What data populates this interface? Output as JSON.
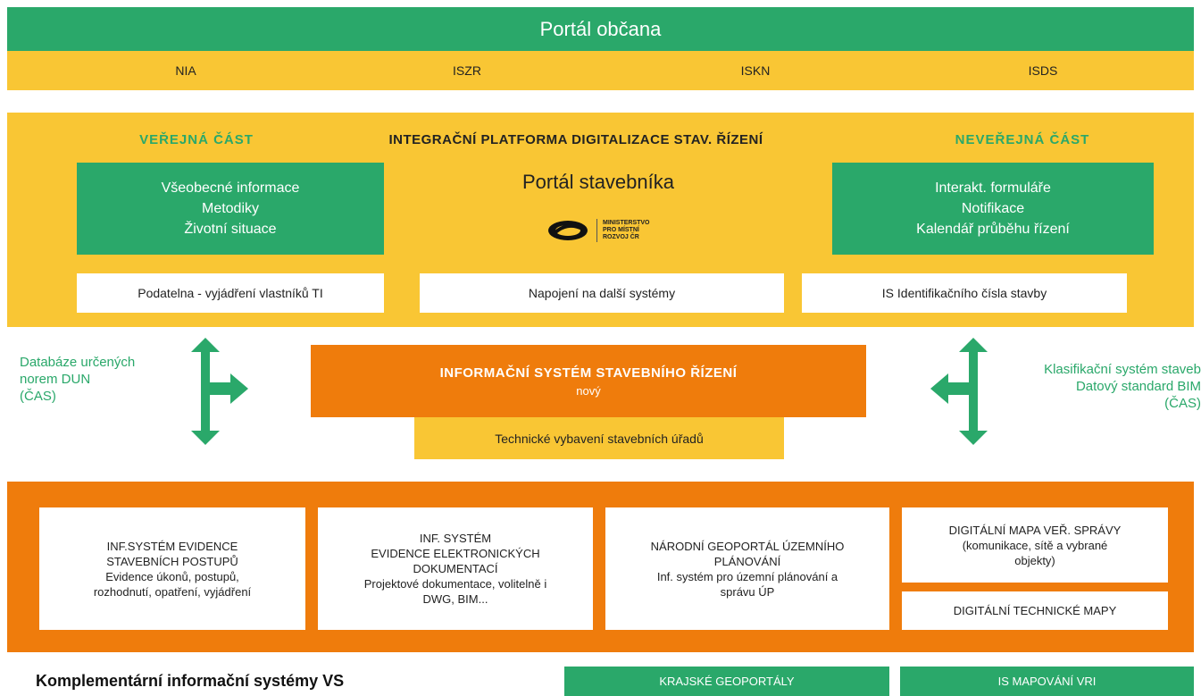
{
  "portal_obcana": "Portál občana",
  "top_systems": [
    "NIA",
    "ISZR",
    "ISKN",
    "ISDS"
  ],
  "platform": {
    "public_label": "VEŘEJNÁ ČÁST",
    "title": "INTEGRAČNÍ PLATFORMA DIGITALIZACE STAV. ŘÍZENÍ",
    "private_label": "NEVEŘEJNÁ ČÁST",
    "left_box": [
      "Všeobecné informace",
      "Metodiky",
      "Životní situace"
    ],
    "center_title": "Portál stavebníka",
    "logo_text": [
      "MINISTERSTVO",
      "PRO MÍSTNÍ",
      "ROZVOJ ČR"
    ],
    "right_box": [
      "Interakt. formuláře",
      "Notifikace",
      "Kalendář průběhu řízení"
    ],
    "white_boxes": [
      "Podatelna - vyjádření vlastníků TI",
      "Napojení na další systémy",
      "IS Identifikačního čísla stavby"
    ]
  },
  "middle": {
    "left_note": [
      "Databáze určených",
      "norem DUN",
      "(ČAS)"
    ],
    "main_title": "INFORMAČNÍ SYSTÉM STAVEBNÍHO ŘÍZENÍ",
    "main_sub": "nový",
    "tech": "Technické vybavení  stavebních úřadů",
    "right_note": [
      "Klasifikační systém staveb",
      "Datový  standard BIM",
      "(ČAS)"
    ]
  },
  "bottom_systems": {
    "box1": [
      "INF.SYSTÉM  EVIDENCE",
      "STAVEBNÍCH POSTUPŮ",
      "Evidence úkonů, postupů,",
      "rozhodnutí, opatření, vyjádření"
    ],
    "box2": [
      "INF. SYSTÉM",
      "EVIDENCE ELEKTRONICKÝCH",
      "DOKUMENTACÍ",
      "Projektové dokumentace, volitelně i",
      "DWG, BIM..."
    ],
    "box3": [
      "NÁRODNÍ GEOPORTÁL ÚZEMNÍHO",
      "PLÁNOVÁNÍ",
      "Inf. systém pro územní plánování a",
      "správu ÚP"
    ],
    "box4": [
      "DIGITÁLNÍ MAPA  VEŘ. SPRÁVY",
      "(komunikace, sítě a vybrané",
      "objekty)"
    ],
    "box5": "DIGITÁLNÍ TECHNICKÉ MAPY"
  },
  "footer": {
    "title": "Komplementární informační systémy VS",
    "krajske": "KRAJSKÉ GEOPORTÁLY",
    "vri": "IS MAPOVÁNÍ  VRI"
  },
  "colors": {
    "green": "#2aa86a",
    "yellow": "#f9c634",
    "orange": "#ef7c0c"
  }
}
